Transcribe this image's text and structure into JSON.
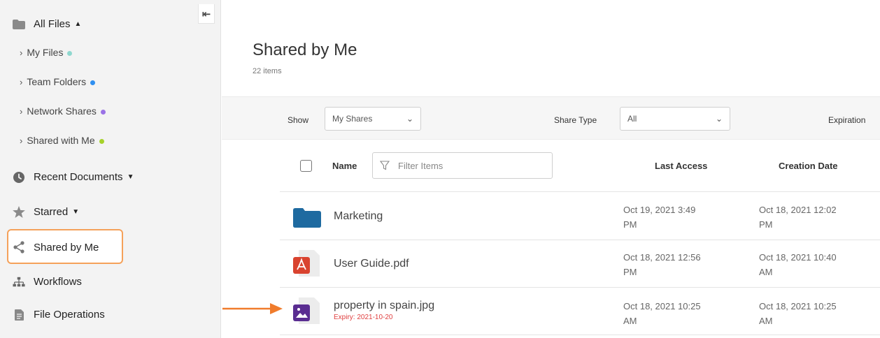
{
  "sidebar": {
    "all_files": "All Files",
    "sub_items": [
      {
        "label": "My Files",
        "dot_color": "#8fd8cf"
      },
      {
        "label": "Team Folders",
        "dot_color": "#2f8ff0"
      },
      {
        "label": "Network Shares",
        "dot_color": "#9a72e6"
      },
      {
        "label": "Shared with Me",
        "dot_color": "#a6d22a"
      }
    ],
    "recent_documents": "Recent Documents",
    "starred": "Starred",
    "shared_by_me": "Shared by Me",
    "workflows": "Workflows",
    "file_operations": "File Operations"
  },
  "header": {
    "title": "Shared by Me",
    "count": "22 items"
  },
  "filters": {
    "show_label": "Show",
    "show_value": "My Shares",
    "share_type_label": "Share Type",
    "share_type_value": "All",
    "expiration_label": "Expiration"
  },
  "table": {
    "col_name": "Name",
    "filter_placeholder": "Filter Items",
    "col_last_access": "Last Access",
    "col_creation_date": "Creation Date",
    "rows": [
      {
        "name": "Marketing",
        "type": "folder-icon",
        "last_access": [
          "Oct 19, 2021 3:49",
          "PM"
        ],
        "created": [
          "Oct 18, 2021 12:02",
          "PM"
        ]
      },
      {
        "name": "User Guide.pdf",
        "type": "pdf-icon",
        "last_access": [
          "Oct 18, 2021 12:56",
          "PM"
        ],
        "created": [
          "Oct 18, 2021 10:40",
          "AM"
        ]
      },
      {
        "name": "property in spain.jpg",
        "type": "image-file-icon",
        "expiry": "Expiry: 2021-10-20",
        "last_access": [
          "Oct 18, 2021 10:25",
          "AM"
        ],
        "created": [
          "Oct 18, 2021 10:25",
          "AM"
        ]
      }
    ]
  },
  "colors": {
    "highlight_border": "#f5a15a",
    "arrow": "#f07c2c",
    "folder": "#1e6aa0",
    "pdf": "#d9432f",
    "image": "#5a2d91",
    "expiry_text": "#e04040"
  }
}
